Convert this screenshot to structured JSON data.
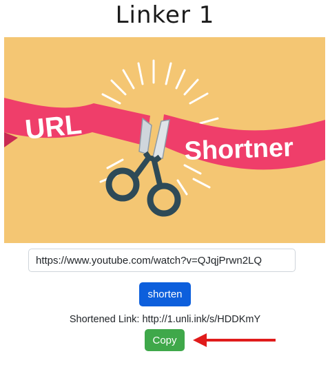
{
  "app": {
    "title": "Linker 1"
  },
  "banner": {
    "word1": "URL",
    "word2": "Shortner"
  },
  "form": {
    "url_value": "https://www.youtube.com/watch?v=QJqjPrwn2LQ",
    "shorten_label": "shorten"
  },
  "result": {
    "text": "Shortened Link: http://1.unli.ink/s/HDDKmY"
  },
  "copy": {
    "label": "Copy"
  },
  "colors": {
    "banner_bg": "#f4c673",
    "ribbon": "#ef3e6a",
    "primary": "#0d5fdc",
    "success": "#3fa84a",
    "arrow": "#e01b1b"
  }
}
